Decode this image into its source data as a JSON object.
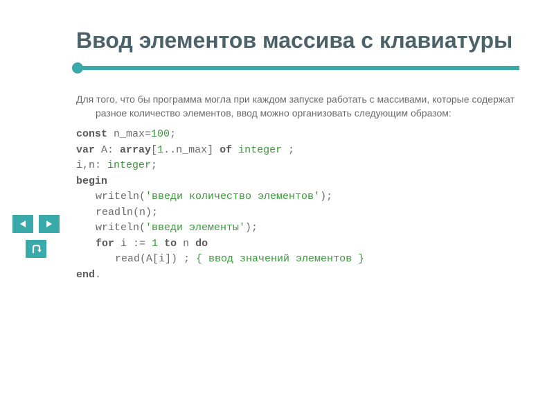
{
  "title": "Ввод элементов массива с клавиатуры",
  "intro": "Для того, что бы программа могла при каждом запуске работать с массивами, которые содержат разное количество элементов, ввод можно организовать следующим образом:",
  "code": {
    "const_kw": "const",
    "const_rest": " n_max=",
    "const_num": "100",
    "semicolon": ";",
    "var_kw": "var",
    "var_name": " A: ",
    "array_kw": "array",
    "array_args": "[",
    "array_one": "1",
    "array_range": "..n_max] ",
    "of_kw": "of",
    "space": " ",
    "integer_kw": "integer",
    "var_line2": "i,n: ",
    "begin_kw": "begin",
    "writeln1_pre": "writeln(",
    "writeln1_str": "'введи количество элементов'",
    "writeln1_post": ");",
    "readln": "readln(n);",
    "writeln2_pre": "writeln(",
    "writeln2_str": "'введи элементы'",
    "writeln2_post": ");",
    "for_kw": "for",
    "for_mid1": " i := ",
    "for_one": "1",
    "to_kw": "to",
    "for_mid2": " n ",
    "do_kw": "do",
    "read_line": "read(A[i]) ; ",
    "read_comment": "{ ввод значений элементов }",
    "end_kw": "end",
    "end_dot": "."
  }
}
